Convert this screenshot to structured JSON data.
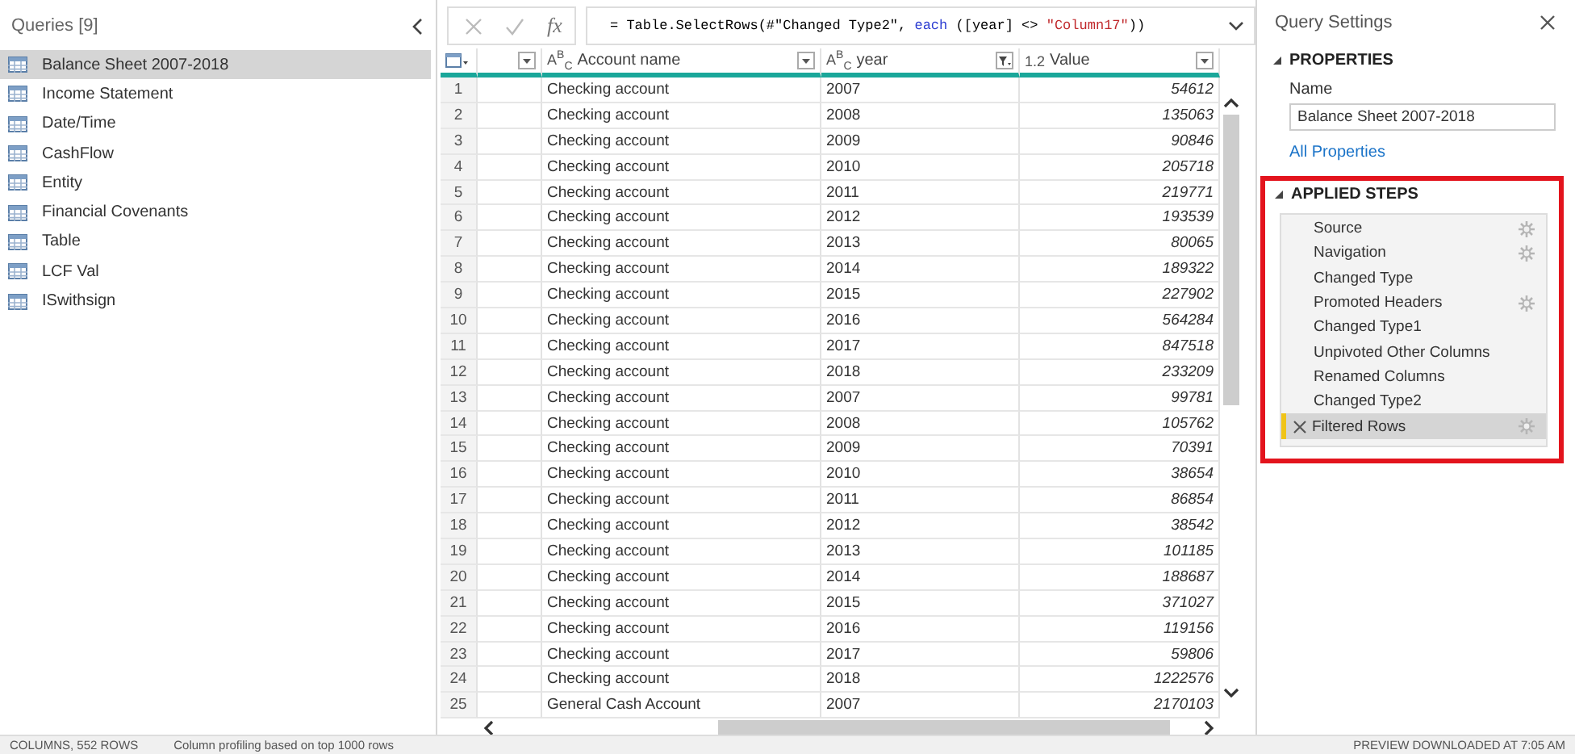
{
  "queries": {
    "title": "Queries [9]",
    "items": [
      {
        "label": "Balance Sheet 2007-2018",
        "selected": true
      },
      {
        "label": "Income Statement",
        "selected": false
      },
      {
        "label": "Date/Time",
        "selected": false
      },
      {
        "label": "CashFlow",
        "selected": false
      },
      {
        "label": "Entity",
        "selected": false
      },
      {
        "label": "Financial Covenants",
        "selected": false
      },
      {
        "label": "Table",
        "selected": false
      },
      {
        "label": "LCF Val",
        "selected": false
      },
      {
        "label": "ISwithsign",
        "selected": false
      }
    ]
  },
  "formula_bar": {
    "fx_label": "fx",
    "segments": [
      {
        "kind": "plain",
        "text": "= Table.SelectRows(#\"Changed Type2\", "
      },
      {
        "kind": "keyword",
        "text": "each"
      },
      {
        "kind": "plain",
        "text": " ([year] <> "
      },
      {
        "kind": "string",
        "text": "\"Column17\""
      },
      {
        "kind": "plain",
        "text": "))"
      }
    ]
  },
  "table": {
    "columns": [
      {
        "filtered": false
      },
      {
        "type_label": "A$^{B}$$_{C}$",
        "label": "Account name",
        "filtered": false
      },
      {
        "type_label": "A$^{B}$$_{C}$",
        "label": "year",
        "filtered": true
      },
      {
        "type_label": "1.2",
        "label": "Value",
        "filtered": false
      }
    ],
    "rows": [
      {
        "index": "1",
        "account": "Checking account",
        "year": "2007",
        "value": "54612"
      },
      {
        "index": "2",
        "account": "Checking account",
        "year": "2008",
        "value": "135063"
      },
      {
        "index": "3",
        "account": "Checking account",
        "year": "2009",
        "value": "90846"
      },
      {
        "index": "4",
        "account": "Checking account",
        "year": "2010",
        "value": "205718"
      },
      {
        "index": "5",
        "account": "Checking account",
        "year": "2011",
        "value": "219771"
      },
      {
        "index": "6",
        "account": "Checking account",
        "year": "2012",
        "value": "193539"
      },
      {
        "index": "7",
        "account": "Checking account",
        "year": "2013",
        "value": "80065"
      },
      {
        "index": "8",
        "account": "Checking account",
        "year": "2014",
        "value": "189322"
      },
      {
        "index": "9",
        "account": "Checking account",
        "year": "2015",
        "value": "227902"
      },
      {
        "index": "10",
        "account": "Checking account",
        "year": "2016",
        "value": "564284"
      },
      {
        "index": "11",
        "account": "Checking account",
        "year": "2017",
        "value": "847518"
      },
      {
        "index": "12",
        "account": "Checking account",
        "year": "2018",
        "value": "233209"
      },
      {
        "index": "13",
        "account": "Checking account",
        "year": "2007",
        "value": "99781"
      },
      {
        "index": "14",
        "account": "Checking account",
        "year": "2008",
        "value": "105762"
      },
      {
        "index": "15",
        "account": "Checking account",
        "year": "2009",
        "value": "70391"
      },
      {
        "index": "16",
        "account": "Checking account",
        "year": "2010",
        "value": "38654"
      },
      {
        "index": "17",
        "account": "Checking account",
        "year": "2011",
        "value": "86854"
      },
      {
        "index": "18",
        "account": "Checking account",
        "year": "2012",
        "value": "38542"
      },
      {
        "index": "19",
        "account": "Checking account",
        "year": "2013",
        "value": "101185"
      },
      {
        "index": "20",
        "account": "Checking account",
        "year": "2014",
        "value": "188687"
      },
      {
        "index": "21",
        "account": "Checking account",
        "year": "2015",
        "value": "371027"
      },
      {
        "index": "22",
        "account": "Checking account",
        "year": "2016",
        "value": "119156"
      },
      {
        "index": "23",
        "account": "Checking account",
        "year": "2017",
        "value": "59806"
      },
      {
        "index": "24",
        "account": "Checking account",
        "year": "2018",
        "value": "1222576"
      },
      {
        "index": "25",
        "account": "General Cash Account",
        "year": "2007",
        "value": "2170103"
      }
    ]
  },
  "query_settings": {
    "title": "Query Settings",
    "properties": {
      "heading": "PROPERTIES",
      "name_label": "Name",
      "name_value": "Balance Sheet 2007-2018",
      "link": "All Properties"
    },
    "applied_steps": {
      "heading": "APPLIED STEPS",
      "highlighted": true,
      "steps": [
        {
          "label": "Source",
          "has_settings": true,
          "selected": false
        },
        {
          "label": "Navigation",
          "has_settings": true,
          "selected": false
        },
        {
          "label": "Changed Type",
          "has_settings": false,
          "selected": false
        },
        {
          "label": "Promoted Headers",
          "has_settings": true,
          "selected": false
        },
        {
          "label": "Changed Type1",
          "has_settings": false,
          "selected": false
        },
        {
          "label": "Unpivoted Other Columns",
          "has_settings": false,
          "selected": false
        },
        {
          "label": "Renamed Columns",
          "has_settings": false,
          "selected": false
        },
        {
          "label": "Changed Type2",
          "has_settings": false,
          "selected": false
        },
        {
          "label": "Filtered Rows",
          "has_settings": true,
          "selected": true
        }
      ]
    }
  },
  "status_bar": {
    "left": "COLUMNS, 552 ROWS",
    "middle": "Column profiling based on top 1000 rows",
    "right": "PREVIEW DOWNLOADED AT 7:05 AM"
  }
}
